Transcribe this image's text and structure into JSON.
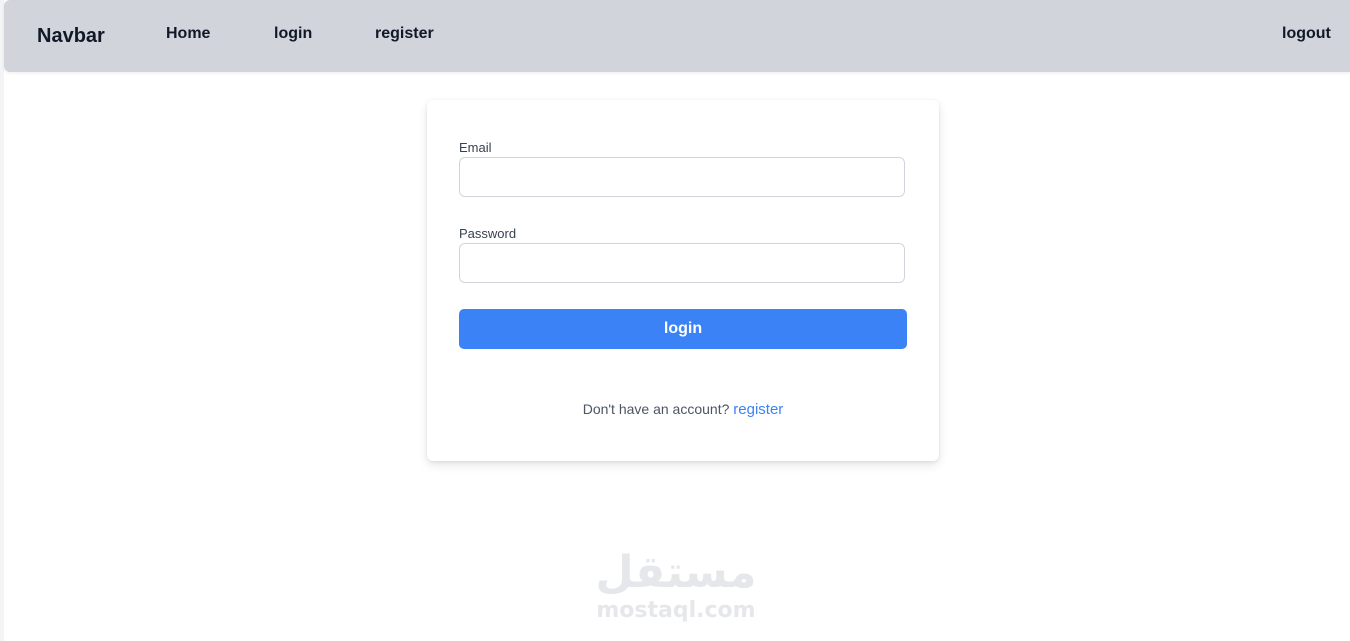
{
  "navbar": {
    "brand": "Navbar",
    "links": {
      "home": "Home",
      "login": "login",
      "register": "register",
      "logout": "logout"
    }
  },
  "login_form": {
    "email_label": "Email",
    "email_value": "",
    "password_label": "Password",
    "password_value": "",
    "submit_label": "login",
    "footer_prompt": "Don't have an account?",
    "footer_link": "register"
  },
  "watermark": {
    "arabic": "مستقل",
    "latin": "mostaql.com"
  },
  "colors": {
    "navbar_bg": "#d1d5db",
    "primary": "#3b82f6",
    "page_bg": "#ffffff"
  }
}
